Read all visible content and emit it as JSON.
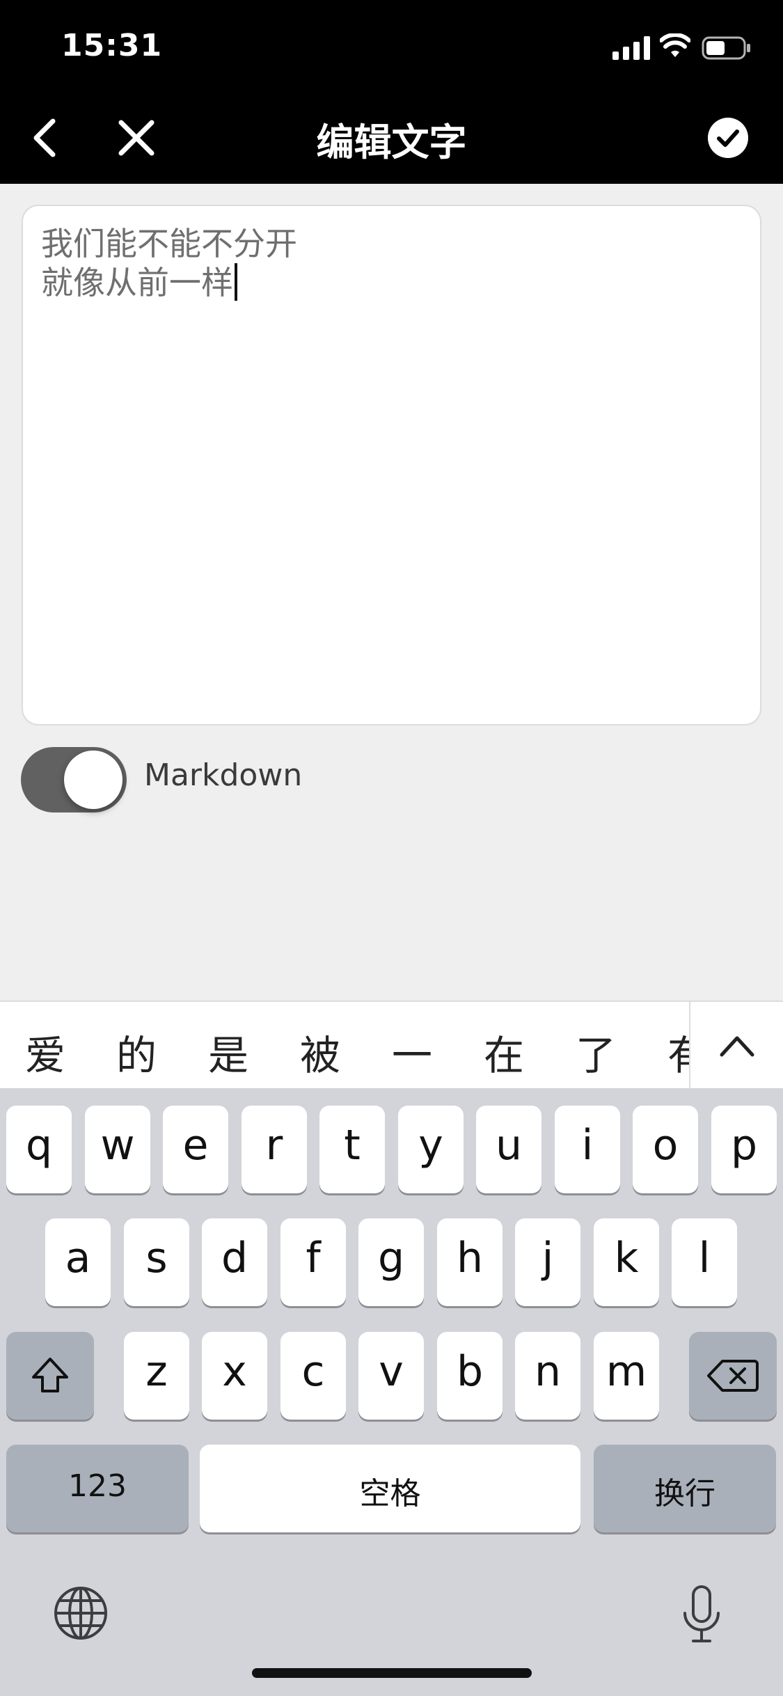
{
  "status_bar": {
    "time": "15:31"
  },
  "nav": {
    "title": "编辑文字"
  },
  "editor": {
    "lines": [
      "我们能不能不分开",
      "就像从前一样"
    ]
  },
  "markdown_toggle": {
    "label": "Markdown",
    "enabled": true
  },
  "candidates": [
    "爱",
    "的",
    "是",
    "被",
    "一",
    "在",
    "了",
    "有"
  ],
  "keyboard": {
    "row1": [
      "q",
      "w",
      "e",
      "r",
      "t",
      "y",
      "u",
      "i",
      "o",
      "p"
    ],
    "row2": [
      "a",
      "s",
      "d",
      "f",
      "g",
      "h",
      "j",
      "k",
      "l"
    ],
    "row3": [
      "z",
      "x",
      "c",
      "v",
      "b",
      "n",
      "m"
    ],
    "numbers_label": "123",
    "space_label": "空格",
    "return_label": "换行"
  }
}
